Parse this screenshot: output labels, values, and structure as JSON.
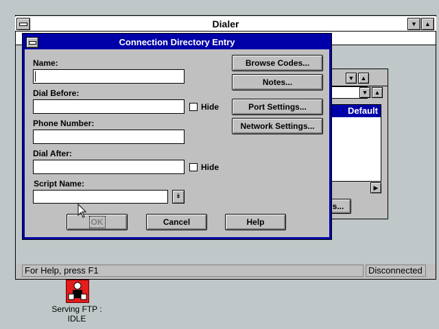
{
  "dialer": {
    "title": "Dialer",
    "status_help": "For Help, press F1",
    "status_conn": "Disconnected",
    "inner_list_header": "Default",
    "inner_button_partial": "s..."
  },
  "dialog": {
    "title": "Connection Directory Entry",
    "fields": {
      "name_label": "Name:",
      "name_value": "",
      "dial_before_label": "Dial Before:",
      "dial_before_value": "",
      "phone_label": "Phone Number:",
      "phone_value": "",
      "dial_after_label": "Dial After:",
      "dial_after_value": "",
      "script_label": "Script Name:",
      "script_value": ""
    },
    "hide_label_1": "Hide",
    "hide_label_2": "Hide",
    "buttons": {
      "browse_codes": "Browse Codes...",
      "notes": "Notes...",
      "port_settings": "Port Settings...",
      "network_settings": "Network Settings...",
      "ok": "OK",
      "cancel": "Cancel",
      "help": "Help"
    }
  },
  "desktop": {
    "icon_label_line1": "Serving FTP :",
    "icon_label_line2": "IDLE"
  },
  "colors": {
    "desktop": "#c0c7c8",
    "caption_active": "#0000a8",
    "icon_red": "#e41c1c"
  }
}
